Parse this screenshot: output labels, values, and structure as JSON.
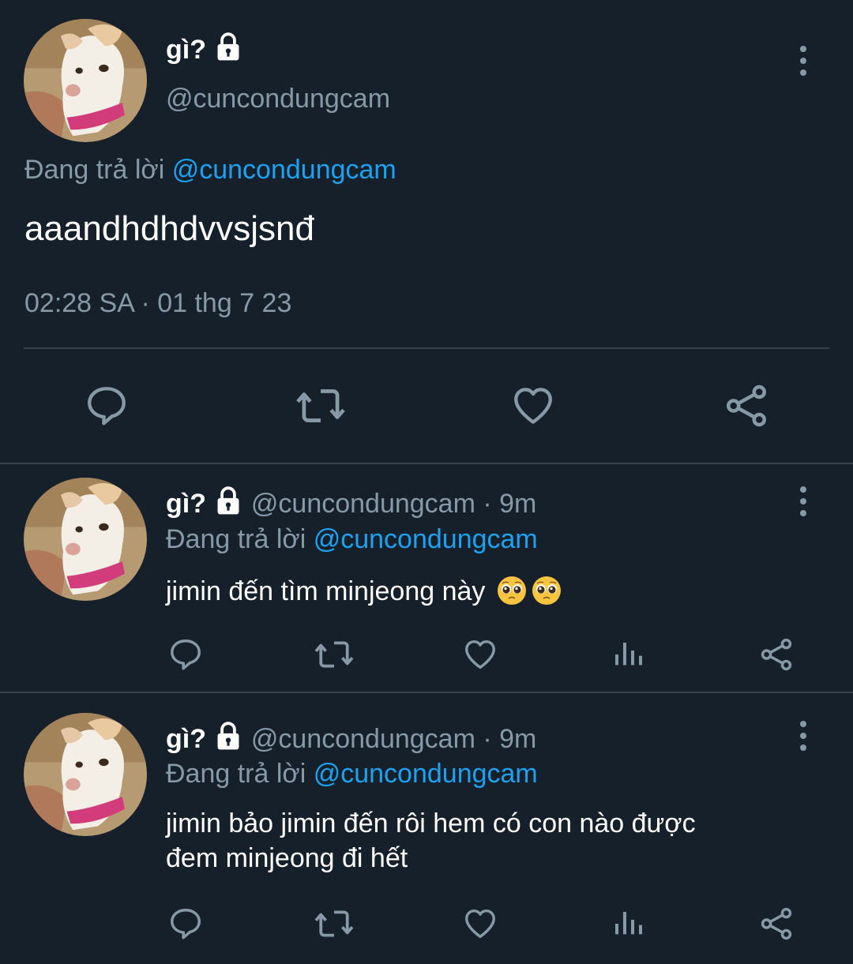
{
  "main_tweet": {
    "display_name": "gì?",
    "handle": "@cuncondungcam",
    "replying_label": "Đang trả lời",
    "replying_to": "@cuncondungcam",
    "text": "aaandhdhdvvsjsnđ",
    "timestamp": "02:28 SA · 01 thg 7 23",
    "icons": [
      "reply-icon",
      "retweet-icon",
      "like-icon",
      "share-icon"
    ]
  },
  "replies": [
    {
      "display_name": "gì?",
      "handle": "@cuncondungcam",
      "time": "· 9m",
      "replying_label": "Đang trả lời",
      "replying_to": "@cuncondungcam",
      "text": "jimin đến tìm minjeong này",
      "emoji": [
        "pleading-face-emoji",
        "pleading-face-emoji"
      ]
    },
    {
      "display_name": "gì?",
      "handle": "@cuncondungcam",
      "time": "· 9m",
      "replying_label": "Đang trả lời",
      "replying_to": "@cuncondungcam",
      "text_line1": "jimin bảo jimin đến rôi hem có con nào được",
      "text_line2": "đem minjeong đi hết"
    }
  ],
  "colors": {
    "background": "#15202b",
    "text": "#ffffff",
    "muted": "#8899a6",
    "link": "#1da1f2",
    "divider": "#38444d"
  }
}
